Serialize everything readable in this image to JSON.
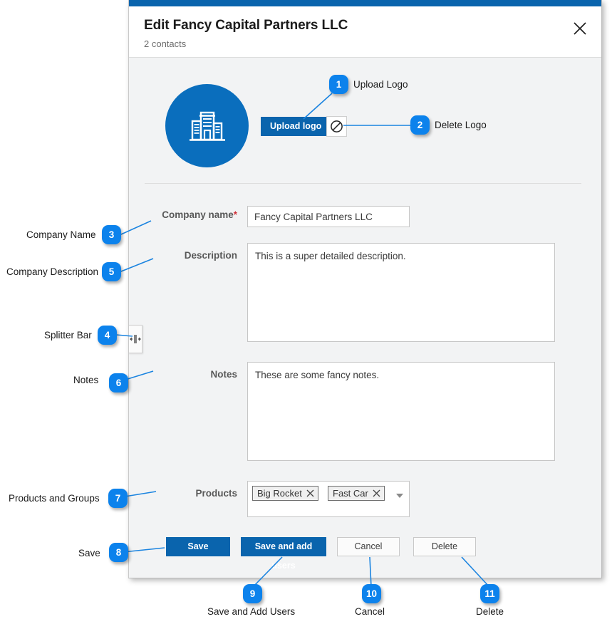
{
  "window": {
    "title": "Edit Fancy Capital Partners LLC",
    "subtitle": "2 contacts",
    "close_icon": "close-icon",
    "accent_color": "#0a64ad",
    "callout_color": "#0c82ec",
    "body_background": "#f2f3f4"
  },
  "logo": {
    "icon": "building-icon",
    "circle_color": "#0a6ebd",
    "upload_button_label": "Upload logo",
    "delete_button_icon": "no-entry-icon"
  },
  "form": {
    "company_name": {
      "label": "Company name",
      "required_marker": "*",
      "value": "Fancy Capital Partners LLC",
      "placeholder": ""
    },
    "description": {
      "label": "Description",
      "value": "This is a super detailed description.",
      "placeholder": ""
    },
    "notes": {
      "label": "Notes",
      "value": "These are some fancy notes.",
      "placeholder": ""
    },
    "products": {
      "label": "Products",
      "tags": [
        {
          "label": "Big Rocket",
          "remove_icon": "close-icon"
        },
        {
          "label": "Fast Car",
          "remove_icon": "close-icon"
        }
      ],
      "caret_icon": "chevron-down-icon"
    },
    "splitter": {
      "icon": "splitter-handle-icon"
    }
  },
  "actions": {
    "save": "Save",
    "save_and_add_users": "Save and add users",
    "cancel": "Cancel",
    "delete": "Delete"
  },
  "callouts": [
    {
      "number": "1",
      "label": "Upload Logo"
    },
    {
      "number": "2",
      "label": "Delete Logo"
    },
    {
      "number": "3",
      "label": "Company Name"
    },
    {
      "number": "4",
      "label": "Splitter Bar"
    },
    {
      "number": "5",
      "label": "Company Description"
    },
    {
      "number": "6",
      "label": "Notes"
    },
    {
      "number": "7",
      "label": "Products and Groups"
    },
    {
      "number": "8",
      "label": "Save"
    },
    {
      "number": "9",
      "label": "Save and Add Users"
    },
    {
      "number": "10",
      "label": "Cancel"
    },
    {
      "number": "11",
      "label": "Delete"
    }
  ]
}
